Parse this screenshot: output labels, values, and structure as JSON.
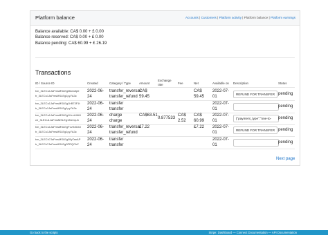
{
  "header": {
    "title": "Platform balance",
    "nav": [
      "Accounts",
      "Customers",
      "Platform activity",
      "Platform balance",
      "Platform earnings"
    ],
    "separator": " | "
  },
  "balances": {
    "available": "Balance available: CA$ 0.00 + £ 0.00",
    "reserved": "Balance reserved: CA$ 0.00 + £ 0.00",
    "pending": "Balance pending: CA$ 60.99 + £ 26.19"
  },
  "transactions": {
    "title": "Transactions",
    "columns": [
      "ID / Source ID",
      "Created",
      "Category / Type",
      "Amount",
      "Exchange rate",
      "Fee",
      "Net",
      "Available on",
      "Description",
      "Status"
    ],
    "rows": [
      {
        "id1": "txn_3LECu1JaFmsMSLEg0lkea3p0",
        "id2": "tr_3LECu1JaFmsMSLEg1py7A3c",
        "created1": "2022-06-",
        "created2": "24",
        "cat1": "transfer_reversal",
        "cat2": "transfer_refund",
        "amount1": "CA$",
        "amount2": "59.45",
        "rate": "",
        "fee1": "",
        "fee2": "",
        "net1": "CA$",
        "net2": "59.45",
        "avail1": "2022-07-",
        "avail2": "01",
        "desc_type": "button",
        "desc": "REFUND FOR TRANSFER",
        "status": "pending"
      },
      {
        "id1": "txn_3LECu1JaFmsMSLEg1hB73F1t",
        "id2": "tr_3LECu1JaFmsMSLEg1py7A3c",
        "created1": "2022-06-",
        "created2": "24",
        "cat1": "transfer",
        "cat2": "transfer",
        "amount1": "",
        "amount2": "",
        "rate": "",
        "fee1": "",
        "fee2": "",
        "net1": "",
        "net2": "",
        "avail1": "2022-07-",
        "avail2": "01",
        "desc_type": "input",
        "desc": "",
        "status": "pending"
      },
      {
        "id1": "txn_3LECu1JaFmsMSLEg1HrcU46H",
        "id2": "ch_3LECu1JaFmsMSLEg13UrnpJx",
        "created1": "2022-06-",
        "created2": "24",
        "cat1": "charge",
        "cat2": "charge",
        "amount1": "CA$63.51",
        "amount2": "",
        "rate": "0.877533",
        "fee1": "CA$",
        "fee2": "2.52",
        "net1": "CA$",
        "net2": "60.99",
        "avail1": "2022-07-",
        "avail2": "01",
        "desc_type": "input",
        "desc": "{\"payment_type\":\"one-to-",
        "status": "pending"
      },
      {
        "id1": "txn_3LECu1JaFmsMSLEgFLvK810U",
        "id2": "tr_3LECu1JaFmsMSLEg1py7A3c",
        "created1": "2022-06-",
        "created2": "24",
        "cat1": "transfer_reversal",
        "cat2": "transfer_refund",
        "amount1": "£7.22",
        "amount2": "",
        "rate": "",
        "fee1": "",
        "fee2": "",
        "net1": "£7.22",
        "net2": "",
        "avail1": "2022-07-",
        "avail2": "01",
        "desc_type": "button",
        "desc": "REFUND FOR TRANSFER",
        "status": "pending"
      },
      {
        "id1": "txn_3LECh7JaFmsMSLEg05yTanAP",
        "id2": "tr_3LECh7JaFmsMSLEg0PRQChZ",
        "created1": "2022-06-",
        "created2": "24",
        "cat1": "transfer",
        "cat2": "transfer",
        "amount1": "",
        "amount2": "",
        "rate": "",
        "fee1": "",
        "fee2": "",
        "net1": "",
        "net2": "",
        "avail1": "2022-07-",
        "avail2": "01",
        "desc_type": "input",
        "desc": "",
        "status": "pending"
      }
    ],
    "next_page": "Next page"
  },
  "footer": {
    "left": "Go back to the scripts",
    "right": "Stripe: Dashboard — Connect Documentation — API Documentation"
  }
}
